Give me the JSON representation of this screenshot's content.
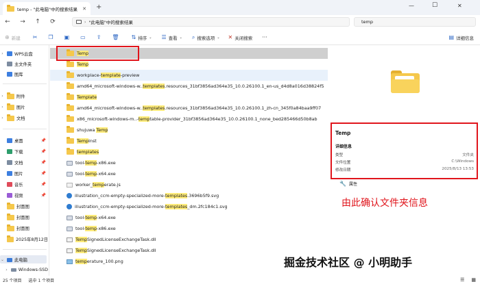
{
  "titlebar": {
    "tab_title": "temp - \"此电脑\"中的搜索结果",
    "tab_close": "✕",
    "new_tab": "+",
    "minimize": "—",
    "maximize": "☐",
    "close": "✕"
  },
  "addressbar": {
    "path": "\"此电脑\"中的搜索结果",
    "search_value": "temp"
  },
  "toolbar": {
    "new": "新建",
    "sort": "排序",
    "view": "查看",
    "search_options": "搜索选项",
    "close_search": "关闭搜索",
    "details_pane": "详细信息"
  },
  "sidebar": {
    "items": [
      {
        "label": "WPS云盘"
      },
      {
        "label": "主文件夹"
      },
      {
        "label": "图库"
      },
      {
        "label": "附件"
      },
      {
        "label": "图片"
      },
      {
        "label": "文档"
      },
      {
        "label": "桌面"
      },
      {
        "label": "下载"
      },
      {
        "label": "文档"
      },
      {
        "label": "图片"
      },
      {
        "label": "音乐"
      },
      {
        "label": "视频"
      },
      {
        "label": "封面图"
      },
      {
        "label": "封面图"
      },
      {
        "label": "封面图"
      },
      {
        "label": "2025年8月12日"
      },
      {
        "label": "此电脑"
      },
      {
        "label": "Windows-SSD"
      }
    ]
  },
  "files": [
    {
      "pre": "",
      "hl": "Temp",
      "post": ""
    },
    {
      "pre": "",
      "hl": "Temp",
      "post": ""
    },
    {
      "pre": "workplace-",
      "hl": "template",
      "post": "-preview"
    },
    {
      "pre": "amd64_microsoft-windows-w..",
      "hl": "templates",
      "post": ".resources_31bf3856ad364e35_10.0.26100.1_en-us_d4d8a016d38824f5"
    },
    {
      "pre": "",
      "hl": "Template",
      "post": ""
    },
    {
      "pre": "amd64_microsoft-windows-w..",
      "hl": "templates",
      "post": ".resources_31bf3856ad364e35_10.0.26100.1_zh-cn_345f0a84baa9ff07"
    },
    {
      "pre": "x86_microsoft-windows-m..-",
      "hl": "temp",
      "post": "table-provider_31bf3856ad364e35_10.0.26100.1_none_bed285466d50b8ab"
    },
    {
      "pre": "shujuwa ",
      "hl": "Temp",
      "post": ""
    },
    {
      "pre": "",
      "hl": "Temp",
      "post": "Inst"
    },
    {
      "pre": "",
      "hl": "templates",
      "post": ""
    },
    {
      "pre": "tool-",
      "hl": "temp",
      "post": "-x86.exe"
    },
    {
      "pre": "tool-",
      "hl": "temp",
      "post": "-x64.exe"
    },
    {
      "pre": "worker_",
      "hl": "temp",
      "post": "erate.js"
    },
    {
      "pre": "illustration_ccm-empty-specialized-more-",
      "hl": "templates",
      "post": ".3696b5f9.svg"
    },
    {
      "pre": "illustration_ccm-empty-specialized-more-",
      "hl": "templates",
      "post": "_dm.2fc184c1.svg"
    },
    {
      "pre": "tool-",
      "hl": "temp",
      "post": "-x64.exe"
    },
    {
      "pre": "tool-",
      "hl": "temp",
      "post": "-x86.exe"
    },
    {
      "pre": "",
      "hl": "Temp",
      "post": "SignedLicenseExchangeTask.dll"
    },
    {
      "pre": "",
      "hl": "Temp",
      "post": "SignedLicenseExchangeTask.dll"
    },
    {
      "pre": "",
      "hl": "temp",
      "post": "erature_100.png"
    }
  ],
  "details": {
    "name": "Temp",
    "section": "详细信息",
    "type_label": "类型",
    "type_value": "文件夹",
    "location_label": "文件位置",
    "location_value": "C:\\Windows",
    "modified_label": "修改日期",
    "modified_value": "2025/8/13 13:53",
    "properties": "属性"
  },
  "annotation": "由此确认文件夹信息",
  "watermark": "掘金技术社区 @ 小明助手",
  "status": {
    "count": "25 个项目",
    "selected": "选中 1 个项目"
  },
  "colors": {
    "highlight": "#ffec7a",
    "annotation_red": "#e0141b",
    "folder_yellow": "#f5c84c"
  }
}
